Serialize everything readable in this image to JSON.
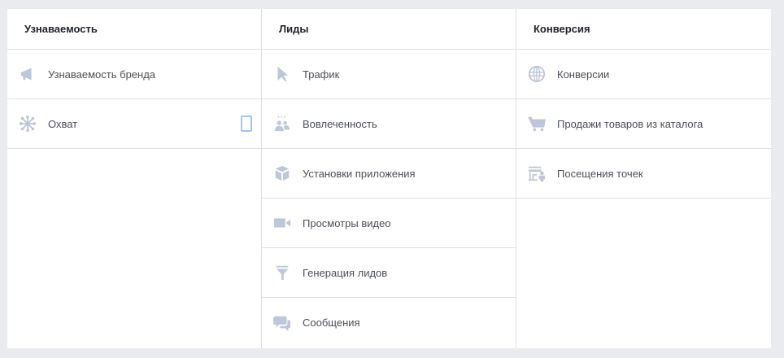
{
  "columns": [
    {
      "title": "Узнаваемость",
      "items": [
        {
          "label": "Узнаваемость бренда",
          "icon": "megaphone-icon"
        },
        {
          "label": "Охват",
          "icon": "reach-icon",
          "badge": "mobile-device-icon"
        }
      ]
    },
    {
      "title": "Лиды",
      "items": [
        {
          "label": "Трафик",
          "icon": "cursor-icon"
        },
        {
          "label": "Вовлеченность",
          "icon": "people-icon"
        },
        {
          "label": "Установки приложения",
          "icon": "box-icon"
        },
        {
          "label": "Просмотры видео",
          "icon": "video-camera-icon"
        },
        {
          "label": "Генерация лидов",
          "icon": "funnel-icon"
        },
        {
          "label": "Сообщения",
          "icon": "chat-bubbles-icon"
        }
      ]
    },
    {
      "title": "Конверсия",
      "items": [
        {
          "label": "Конверсии",
          "icon": "globe-icon"
        },
        {
          "label": "Продажи товаров из каталога",
          "icon": "cart-icon"
        },
        {
          "label": "Посещения точек",
          "icon": "store-visit-icon"
        }
      ]
    }
  ],
  "colors": {
    "icon": "#bec7d9",
    "text": "#4b4f56",
    "border": "#dddfe2",
    "background": "#e9ebee"
  }
}
